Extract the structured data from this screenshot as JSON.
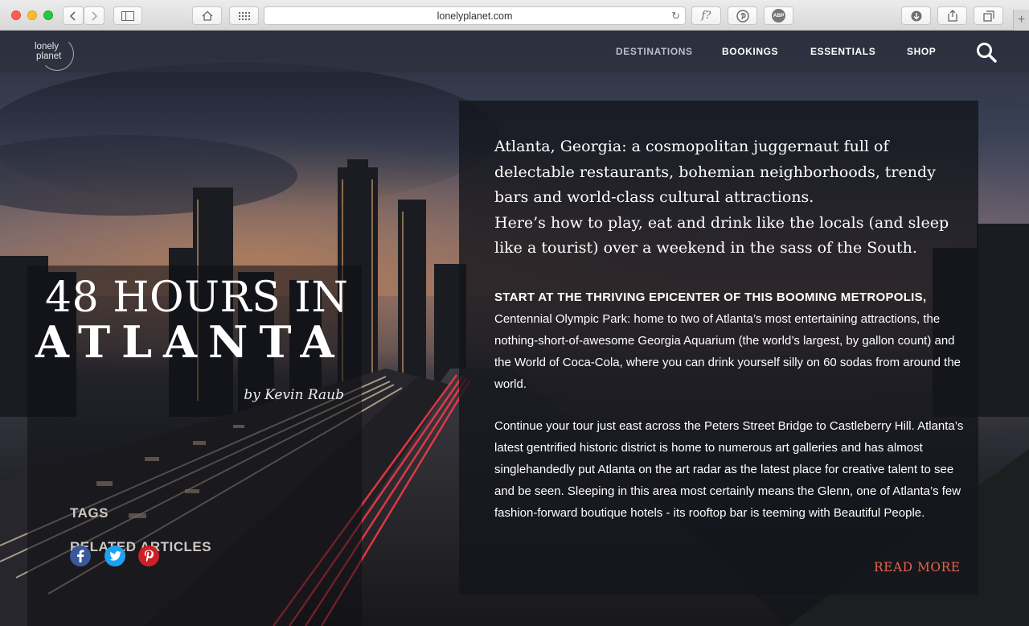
{
  "browser": {
    "url": "lonelyplanet.com",
    "reader_button": "f?",
    "adblock_label": "ABP",
    "new_tab": "+"
  },
  "site": {
    "logo_line1": "lonely",
    "logo_line2": "planet",
    "nav": [
      "DESTINATIONS",
      "BOOKINGS",
      "ESSENTIALS",
      "SHOP"
    ]
  },
  "article": {
    "title_line1": "48 HOURS IN",
    "title_line2": "ATLANTA",
    "byline": "by Kevin Raub",
    "side_links": [
      "TAGS",
      "RELATED ARTICLES"
    ],
    "social": [
      "facebook-icon",
      "twitter-icon",
      "pinterest-icon"
    ],
    "intro_p1": "Atlanta, Georgia: a cosmopolitan juggernaut full of delectable restaurants, bohemian neighborhoods, trendy bars and world-class cultural attractions.",
    "intro_p2": "Here’s how to play, eat and drink like the locals (and sleep like a tourist) over a weekend in the sass of the South.",
    "para1_lead": "START AT THE THRIVING EPICENTER OF THIS BOOMING METROPOLIS,",
    "para1_rest": "Centennial Olympic Park: home to two of Atlanta’s most entertaining attractions, the nothing-short-of-awesome Georgia Aquarium (the world’s largest, by gallon count) and the World of Coca-Cola, where you can drink yourself silly on 60 sodas from around the world.",
    "para2": "Continue your tour just east across the Peters Street Bridge to Castleberry Hill. Atlanta’s latest gentrified historic district is home to numerous art galleries and has almost singlehandedly put Atlanta on the art radar as the latest place for creative talent to see and be seen. Sleeping in this area most certainly means the Glenn, one of Atlanta’s few fashion-forward boutique hotels - its rooftop bar is teeming with Beautiful People.",
    "read_more": "READ MORE"
  },
  "colors": {
    "accent": "#e6614a",
    "facebook": "#3b5998",
    "twitter": "#1da1f2",
    "pinterest": "#cb2027"
  }
}
